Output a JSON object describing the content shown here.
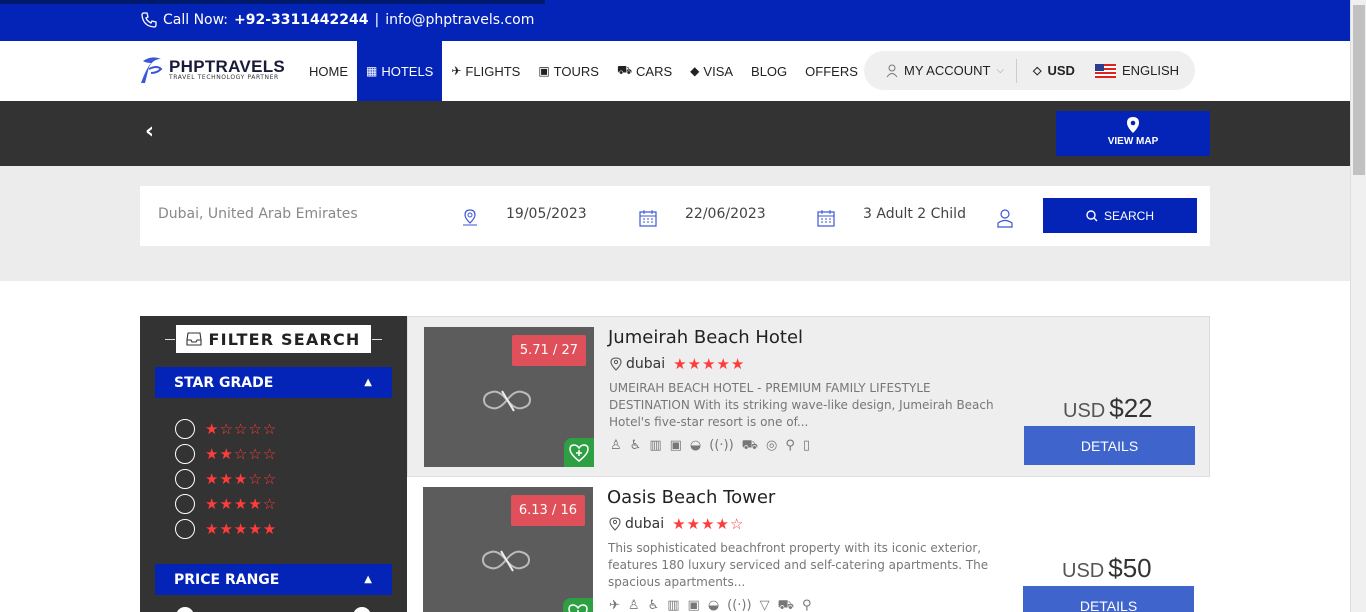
{
  "topbar": {
    "call_label": "Call Now:",
    "phone": "+92-3311442244",
    "separator": "|",
    "email": "info@phptravels.com"
  },
  "logo": {
    "name": "PHPTRAVELS",
    "tagline": "TRAVEL TECHNOLOGY PARTNER"
  },
  "nav": {
    "items": [
      {
        "label": "HOME",
        "icon": ""
      },
      {
        "label": "HOTELS",
        "icon": "building-icon"
      },
      {
        "label": "FLIGHTS",
        "icon": "plane-icon"
      },
      {
        "label": "TOURS",
        "icon": "suitcase-icon"
      },
      {
        "label": "CARS",
        "icon": "car-icon"
      },
      {
        "label": "VISA",
        "icon": "tag-icon"
      },
      {
        "label": "BLOG",
        "icon": ""
      },
      {
        "label": "OFFERS",
        "icon": ""
      }
    ],
    "account": "MY ACCOUNT",
    "currency": "USD",
    "language": "ENGLISH"
  },
  "band": {
    "view_map": "VIEW MAP"
  },
  "search": {
    "destination": "Dubai, United Arab Emirates",
    "checkin": "19/05/2023",
    "checkout": "22/06/2023",
    "guests": "3 Adult 2 Child",
    "button": "SEARCH"
  },
  "filter": {
    "title": "FILTER SEARCH",
    "star_grade": "STAR GRADE",
    "price_range": "PRICE RANGE",
    "star_options": [
      1,
      2,
      3,
      4,
      5
    ]
  },
  "hotels": [
    {
      "name": "Jumeirah Beach Hotel",
      "location": "dubai",
      "stars": 5,
      "rating": "5.71 / 27",
      "description": "UMEIRAH BEACH HOTEL - PREMIUM FAMILY LIFESTYLE DESTINATION With its striking wave-like design, Jumeirah Beach Hotel's five-star resort is one of...",
      "currency": "USD",
      "price": "$22",
      "details": "DETAILS"
    },
    {
      "name": "Oasis Beach Tower",
      "location": "dubai",
      "stars": 4,
      "rating": "6.13 / 16",
      "description": "This sophisticated beachfront property with its iconic exterior, features 180 luxury serviced and self-catering apartments. The spacious apartments...",
      "currency": "USD",
      "price": "$50",
      "details": "DETAILS"
    }
  ],
  "colors": {
    "primary": "#0424b8",
    "dark": "#333333",
    "accent_red": "#e0505a",
    "star": "#ff3c3c",
    "details_btn": "#3f64cc"
  }
}
